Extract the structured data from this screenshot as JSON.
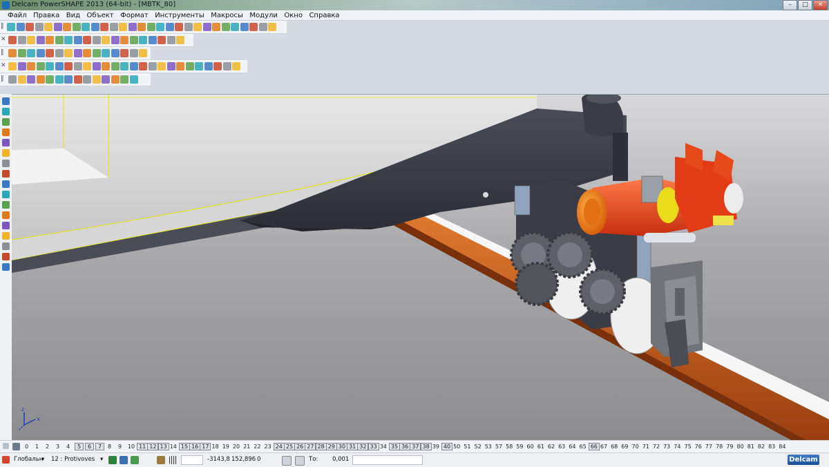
{
  "window": {
    "title": "Delcam PowerSHAPE 2013 (64-bit) - [MBTK_80]",
    "controls": {
      "minimize": "–",
      "maximize": "□",
      "close": "✕"
    }
  },
  "menu": [
    "Файл",
    "Правка",
    "Вид",
    "Объект",
    "Формат",
    "Инструменты",
    "Макросы",
    "Модули",
    "Окно",
    "Справка"
  ],
  "toolbars": {
    "grip_symbol": "‖",
    "close_symbol": "✕"
  },
  "levels": {
    "items": [
      "0",
      "1",
      "2",
      "3",
      "4",
      "5",
      "6",
      "7",
      "8",
      "9",
      "10",
      "11",
      "12",
      "13",
      "14",
      "15",
      "16",
      "17",
      "18",
      "19",
      "20",
      "21",
      "22",
      "23",
      "24",
      "25",
      "26",
      "27",
      "28",
      "29",
      "30",
      "31",
      "32",
      "33",
      "34",
      "35",
      "36",
      "37",
      "38",
      "39",
      "40",
      "50",
      "51",
      "52",
      "53",
      "57",
      "58",
      "59",
      "60",
      "61",
      "62",
      "63",
      "64",
      "65",
      "66",
      "67",
      "68",
      "69",
      "70",
      "71",
      "72",
      "73",
      "74",
      "75",
      "76",
      "77",
      "78",
      "79",
      "80",
      "81",
      "82",
      "83",
      "84"
    ],
    "boxed": [
      "5",
      "6",
      "7",
      "11",
      "12",
      "13",
      "15",
      "16",
      "17",
      "24",
      "25",
      "26",
      "27",
      "28",
      "29",
      "30",
      "31",
      "32",
      "33",
      "35",
      "36",
      "37",
      "38",
      "40",
      "66"
    ]
  },
  "status": {
    "workplane": "Глобальн",
    "level_selector": "12 : Protivoves",
    "coord_x": "-3143,8",
    "coord_y": "152,896",
    "coord_z": "0",
    "tolerance_label": "То:",
    "tolerance_value": "0,001",
    "brand": "Delcam"
  },
  "axis_indicator": {
    "x": "x",
    "y": "y",
    "z": "z"
  },
  "colors": {
    "rail": "#c0561b",
    "motor": "#e8481c",
    "motor_endcap": "#f28a1e",
    "coupling": "#e8d814",
    "frame_dark": "#3b3d47",
    "body_light": "#cfcfcf",
    "edge_highlight": "#e6e600"
  }
}
